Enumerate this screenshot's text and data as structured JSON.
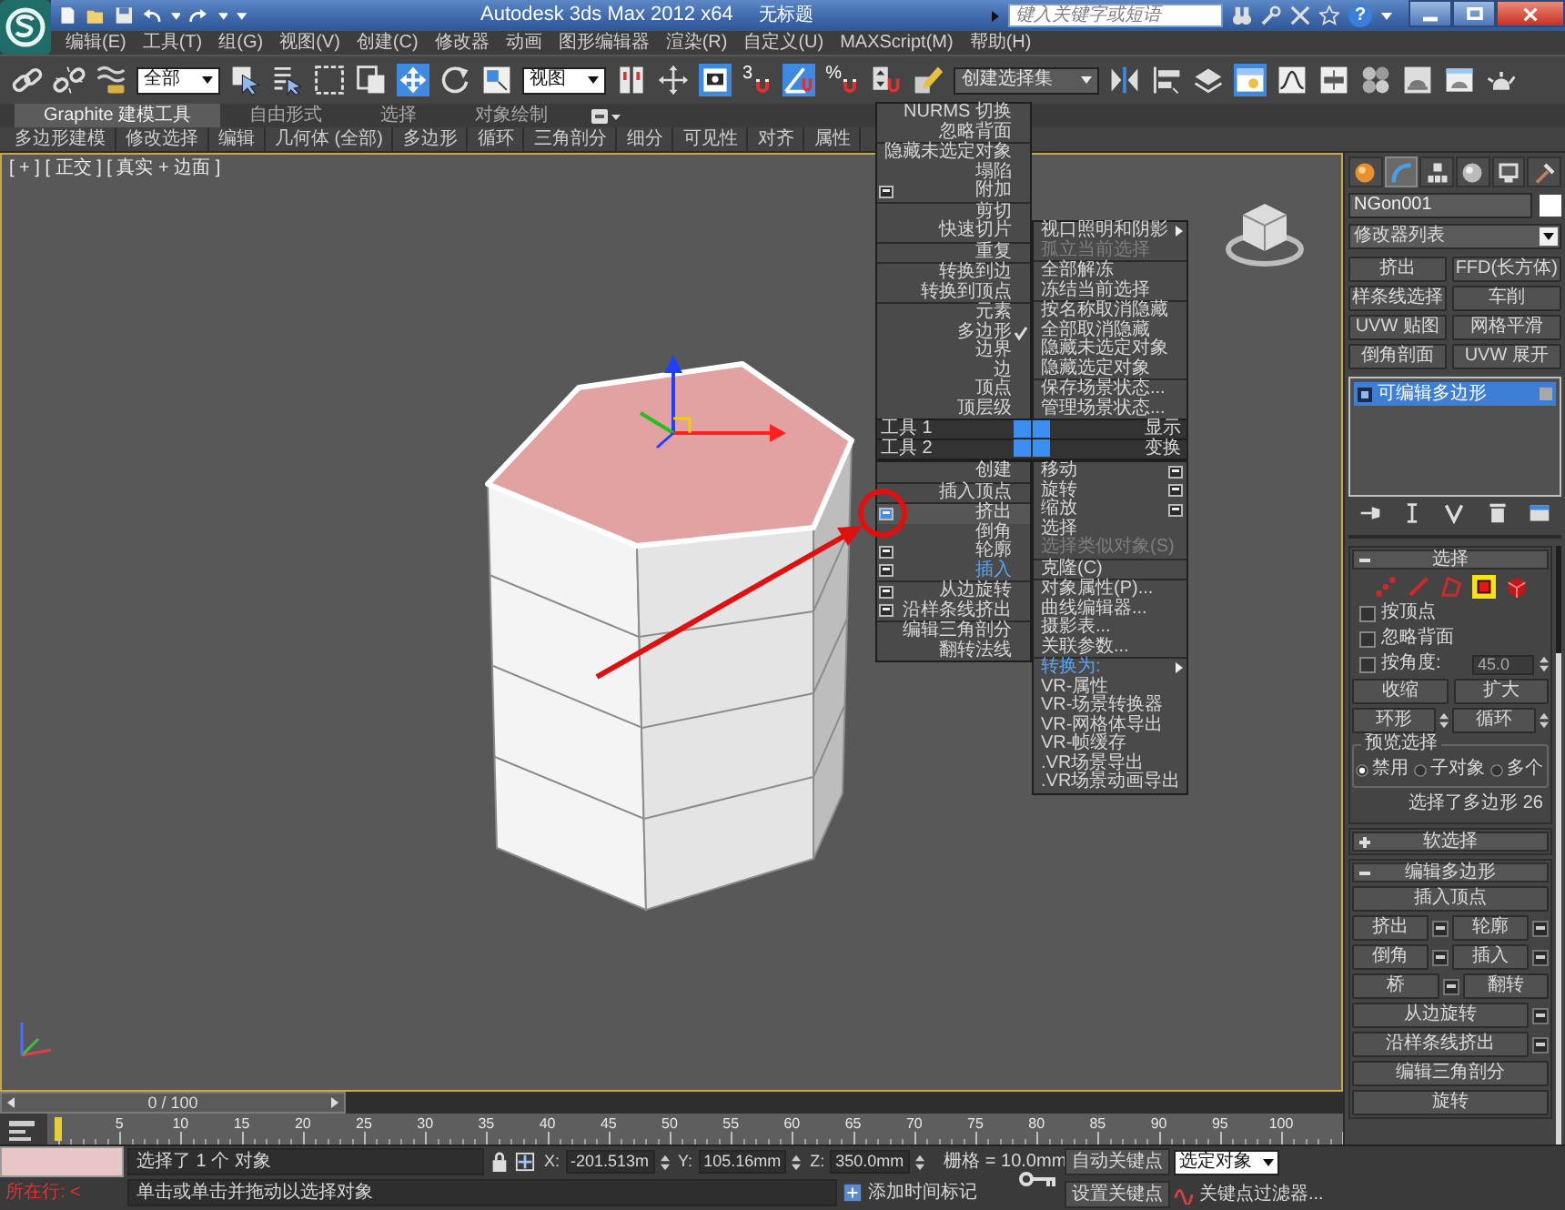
{
  "title_bar": {
    "title": "Autodesk 3ds Max  2012 x64",
    "document": "无标题",
    "search": {
      "placeholder": "键入关键字或短语"
    },
    "help": "?"
  },
  "menu_bar": [
    "编辑(E)",
    "工具(T)",
    "组(G)",
    "视图(V)",
    "创建(C)",
    "修改器",
    "动画",
    "图形编辑器",
    "渲染(R)",
    "自定义(U)",
    "MAXScript(M)",
    "帮助(H)"
  ],
  "main_toolbar": [
    {
      "kind": "tool",
      "selected": false
    },
    {
      "kind": "tool",
      "selected": false
    },
    {
      "kind": "tool",
      "selected": false
    },
    {
      "kind": "dropdown",
      "value": "全部"
    },
    {
      "kind": "tool",
      "selected": false
    },
    {
      "kind": "tool",
      "selected": false
    },
    {
      "kind": "tool",
      "selected": false
    },
    {
      "kind": "tool",
      "selected": false
    },
    {
      "kind": "tool",
      "selected": true
    },
    {
      "kind": "tool",
      "selected": false
    },
    {
      "kind": "tool",
      "selected": false
    },
    {
      "kind": "dropdown",
      "value": "视图"
    },
    {
      "kind": "tool",
      "selected": false
    },
    {
      "kind": "tool",
      "selected": false
    },
    {
      "kind": "tool",
      "selected": true
    },
    {
      "kind": "tool",
      "selected": false,
      "text": "3"
    },
    {
      "kind": "tool",
      "selected": true
    },
    {
      "kind": "tool",
      "selected": false,
      "text": "%"
    },
    {
      "kind": "tool",
      "selected": false
    },
    {
      "kind": "tool",
      "selected": false
    },
    {
      "kind": "combo",
      "value": "创建选择集"
    },
    {
      "kind": "tool",
      "selected": false
    },
    {
      "kind": "tool",
      "selected": false
    },
    {
      "kind": "tool",
      "selected": false
    },
    {
      "kind": "tool",
      "selected": true
    },
    {
      "kind": "tool",
      "selected": false
    },
    {
      "kind": "tool",
      "selected": false
    },
    {
      "kind": "tool",
      "selected": false
    },
    {
      "kind": "tool",
      "selected": false
    },
    {
      "kind": "tool",
      "selected": false
    },
    {
      "kind": "tool",
      "selected": false
    }
  ],
  "ribbon": {
    "tabs": [
      {
        "label": "Graphite 建模工具",
        "selected": true
      },
      {
        "label": "自由形式",
        "selected": false
      },
      {
        "label": "选择",
        "selected": false
      },
      {
        "label": "对象绘制",
        "selected": false
      }
    ],
    "panels": [
      "多边形建模",
      "修改选择",
      "编辑",
      "几何体 (全部)",
      "多边形",
      "循环",
      "三角剖分",
      "细分",
      "可见性",
      "对齐",
      "属性"
    ]
  },
  "viewport": {
    "label": "[ + ] [ 正交 ] [ 真实 + 边面 ]",
    "top_face_selected": true
  },
  "quad_menu": {
    "upper_left": [
      [
        {
          "label": "NURMS 切换",
          "checked": false,
          "option_box": false
        },
        {
          "label": "忽略背面",
          "checked": false,
          "option_box": false
        }
      ],
      [
        {
          "label": "隐藏未选定对象",
          "checked": false,
          "option_box": false
        },
        {
          "label": "塌陷",
          "checked": false,
          "option_box": false
        },
        {
          "label": "附加",
          "checked": false,
          "option_box": true
        }
      ],
      [
        {
          "label": "剪切",
          "checked": false,
          "option_box": false
        },
        {
          "label": "快速切片",
          "checked": false,
          "option_box": false
        }
      ],
      [
        {
          "label": "重复",
          "checked": false,
          "option_box": false
        }
      ],
      [
        {
          "label": "转换到边",
          "checked": false,
          "option_box": false
        },
        {
          "label": "转换到顶点",
          "checked": false,
          "option_box": false
        }
      ],
      [
        {
          "label": "元素",
          "checked": false,
          "option_box": false
        },
        {
          "label": "多边形",
          "checked": true,
          "option_box": false
        },
        {
          "label": "边界",
          "checked": false,
          "option_box": false
        },
        {
          "label": "边",
          "checked": false,
          "option_box": false
        },
        {
          "label": "顶点",
          "checked": false,
          "option_box": false
        },
        {
          "label": "顶层级",
          "checked": false,
          "option_box": false
        }
      ]
    ],
    "upper_right": [
      [
        {
          "label": "视口照明和阴影",
          "disabled": false,
          "submenu": true
        },
        {
          "label": "孤立当前选择",
          "disabled": true,
          "submenu": false
        }
      ],
      [
        {
          "label": "全部解冻",
          "disabled": false,
          "submenu": false
        },
        {
          "label": "冻结当前选择",
          "disabled": false,
          "submenu": false
        }
      ],
      [
        {
          "label": "按名称取消隐藏",
          "disabled": false,
          "submenu": false
        },
        {
          "label": "全部取消隐藏",
          "disabled": false,
          "submenu": false
        },
        {
          "label": "隐藏未选定对象",
          "disabled": false,
          "submenu": false
        },
        {
          "label": "隐藏选定对象",
          "disabled": false,
          "submenu": false
        }
      ],
      [
        {
          "label": "保存场景状态...",
          "disabled": false,
          "submenu": false
        },
        {
          "label": "管理场景状态...",
          "disabled": false,
          "submenu": false
        }
      ]
    ],
    "headers": [
      {
        "left": "工具 1",
        "right": "显示"
      },
      {
        "left": "工具 2",
        "right": "变换"
      }
    ],
    "lower_left": [
      [
        {
          "label": "创建",
          "option_box": false,
          "option_hover": false,
          "highlighted": false
        }
      ],
      [
        {
          "label": "插入顶点",
          "option_box": false,
          "option_hover": false,
          "highlighted": false
        }
      ],
      [
        {
          "label": "挤出",
          "option_box": true,
          "option_hover": true,
          "highlighted": false
        },
        {
          "label": "倒角",
          "option_box": false,
          "option_hover": false,
          "highlighted": false
        },
        {
          "label": "轮廓",
          "option_box": true,
          "option_hover": false,
          "highlighted": false
        },
        {
          "label": "插入",
          "option_box": true,
          "option_hover": false,
          "highlighted": true
        }
      ],
      [
        {
          "label": "从边旋转",
          "option_box": true,
          "option_hover": false,
          "highlighted": false
        },
        {
          "label": "沿样条线挤出",
          "option_box": true,
          "option_hover": false,
          "highlighted": false
        }
      ],
      [
        {
          "label": "编辑三角剖分",
          "option_box": false,
          "option_hover": false,
          "highlighted": false
        },
        {
          "label": "翻转法线",
          "option_box": false,
          "option_hover": false,
          "highlighted": false
        }
      ]
    ],
    "lower_right": [
      [
        {
          "label": "移动",
          "option_box": true,
          "disabled": false,
          "submenu": false,
          "highlighted": false
        },
        {
          "label": "旋转",
          "option_box": true,
          "disabled": false,
          "submenu": false,
          "highlighted": false
        },
        {
          "label": "缩放",
          "option_box": true,
          "disabled": false,
          "submenu": false,
          "highlighted": false
        },
        {
          "label": "选择",
          "option_box": false,
          "disabled": false,
          "submenu": false,
          "highlighted": false
        },
        {
          "label": "选择类似对象(S)",
          "option_box": false,
          "disabled": true,
          "submenu": false,
          "highlighted": false
        }
      ],
      [
        {
          "label": "克隆(C)",
          "option_box": false,
          "disabled": false,
          "submenu": false,
          "highlighted": false
        }
      ],
      [
        {
          "label": "对象属性(P)...",
          "option_box": false,
          "disabled": false,
          "submenu": false,
          "highlighted": false
        },
        {
          "label": "曲线编辑器...",
          "option_box": false,
          "disabled": false,
          "submenu": false,
          "highlighted": false
        },
        {
          "label": "摄影表...",
          "option_box": false,
          "disabled": false,
          "submenu": false,
          "highlighted": false
        },
        {
          "label": "关联参数...",
          "option_box": false,
          "disabled": false,
          "submenu": false,
          "highlighted": false
        }
      ],
      [
        {
          "label": "转换为:",
          "option_box": false,
          "disabled": false,
          "submenu": true,
          "highlighted": true
        },
        {
          "label": "VR-属性",
          "option_box": false,
          "disabled": false,
          "submenu": false,
          "highlighted": false
        },
        {
          "label": "VR-场景转换器",
          "option_box": false,
          "disabled": false,
          "submenu": false,
          "highlighted": false
        },
        {
          "label": "VR-网格体导出",
          "option_box": false,
          "disabled": false,
          "submenu": false,
          "highlighted": false
        },
        {
          "label": "VR-帧缓存",
          "option_box": false,
          "disabled": false,
          "submenu": false,
          "highlighted": false
        },
        {
          "label": ".VR场景导出",
          "option_box": false,
          "disabled": false,
          "submenu": false,
          "highlighted": false
        },
        {
          "label": ".VR场景动画导出",
          "option_box": false,
          "disabled": false,
          "submenu": false,
          "highlighted": false
        }
      ]
    ]
  },
  "command_panel": {
    "tabs": [
      {
        "selected": false
      },
      {
        "selected": true
      },
      {
        "selected": false
      },
      {
        "selected": false
      },
      {
        "selected": false
      },
      {
        "selected": false
      }
    ],
    "object_name": "NGon001",
    "modifier_list": "修改器列表",
    "modifier_buttons": [
      "挤出",
      "FFD(长方体)",
      "样条线选择",
      "车削",
      "UVW 贴图",
      "网格平滑",
      "倒角剖面",
      "UVW 展开"
    ],
    "stack": [
      {
        "label": "可编辑多边形",
        "selected": true
      }
    ],
    "selection": {
      "title": "选择",
      "expanded": true,
      "levels": [
        {
          "selected": false
        },
        {
          "selected": false
        },
        {
          "selected": false
        },
        {
          "selected": true
        },
        {
          "selected": false
        }
      ],
      "checkboxes": [
        {
          "label": "按顶点",
          "checked": false
        },
        {
          "label": "忽略背面",
          "checked": false
        },
        {
          "label": "按角度:",
          "checked": false,
          "value": "45.0"
        }
      ],
      "buttons": [
        "收缩",
        "扩大"
      ],
      "spinner_buttons": [
        "环形",
        "循环"
      ],
      "preview": {
        "title": "预览选择",
        "options": [
          {
            "label": "禁用",
            "selected": true
          },
          {
            "label": "子对象",
            "selected": false
          },
          {
            "label": "多个",
            "selected": false
          }
        ]
      },
      "status": "选择了多边形 26"
    },
    "soft_selection": {
      "title": "软选择",
      "expanded": false
    },
    "edit_polygons": {
      "title": "编辑多边形",
      "expanded": true,
      "rows": [
        [
          {
            "label": "插入顶点",
            "option_box": false
          }
        ],
        [
          {
            "label": "挤出",
            "option_box": true
          },
          {
            "label": "轮廓",
            "option_box": true
          }
        ],
        [
          {
            "label": "倒角",
            "option_box": true
          },
          {
            "label": "插入",
            "option_box": true
          }
        ],
        [
          {
            "label": "桥",
            "option_box": true
          },
          {
            "label": "翻转",
            "option_box": false
          }
        ],
        [
          {
            "label": "从边旋转",
            "option_box": true
          }
        ],
        [
          {
            "label": "沿样条线挤出",
            "option_box": true
          }
        ],
        [
          {
            "label": "编辑三角剖分",
            "option_box": false
          }
        ],
        [
          {
            "label": "旋转",
            "option_box": false
          }
        ]
      ]
    }
  },
  "time_slider": {
    "frame": "0 / 100"
  },
  "track_bar": {
    "labels": [
      "5",
      "10",
      "15",
      "20",
      "25",
      "30",
      "35",
      "40",
      "45",
      "50",
      "55",
      "60",
      "65",
      "70",
      "75",
      "80",
      "85",
      "90",
      "95",
      "100"
    ]
  },
  "status_bar": {
    "listener_line": "所在行: <",
    "selection": "选择了 1 个 对象",
    "prompt": "单击或单击并拖动以选择对象",
    "coordinates": [
      {
        "axis": "X:",
        "value": "-201.513m"
      },
      {
        "axis": "Y:",
        "value": "105.16mm"
      },
      {
        "axis": "Z:",
        "value": "350.0mm"
      }
    ],
    "grid": "栅格 = 10.0mm",
    "time_tag": "添加时间标记",
    "auto_key": "自动关键点",
    "key_mode": "选定对象",
    "set_key": "设置关键点",
    "key_filters": "关键点过滤器..."
  }
}
